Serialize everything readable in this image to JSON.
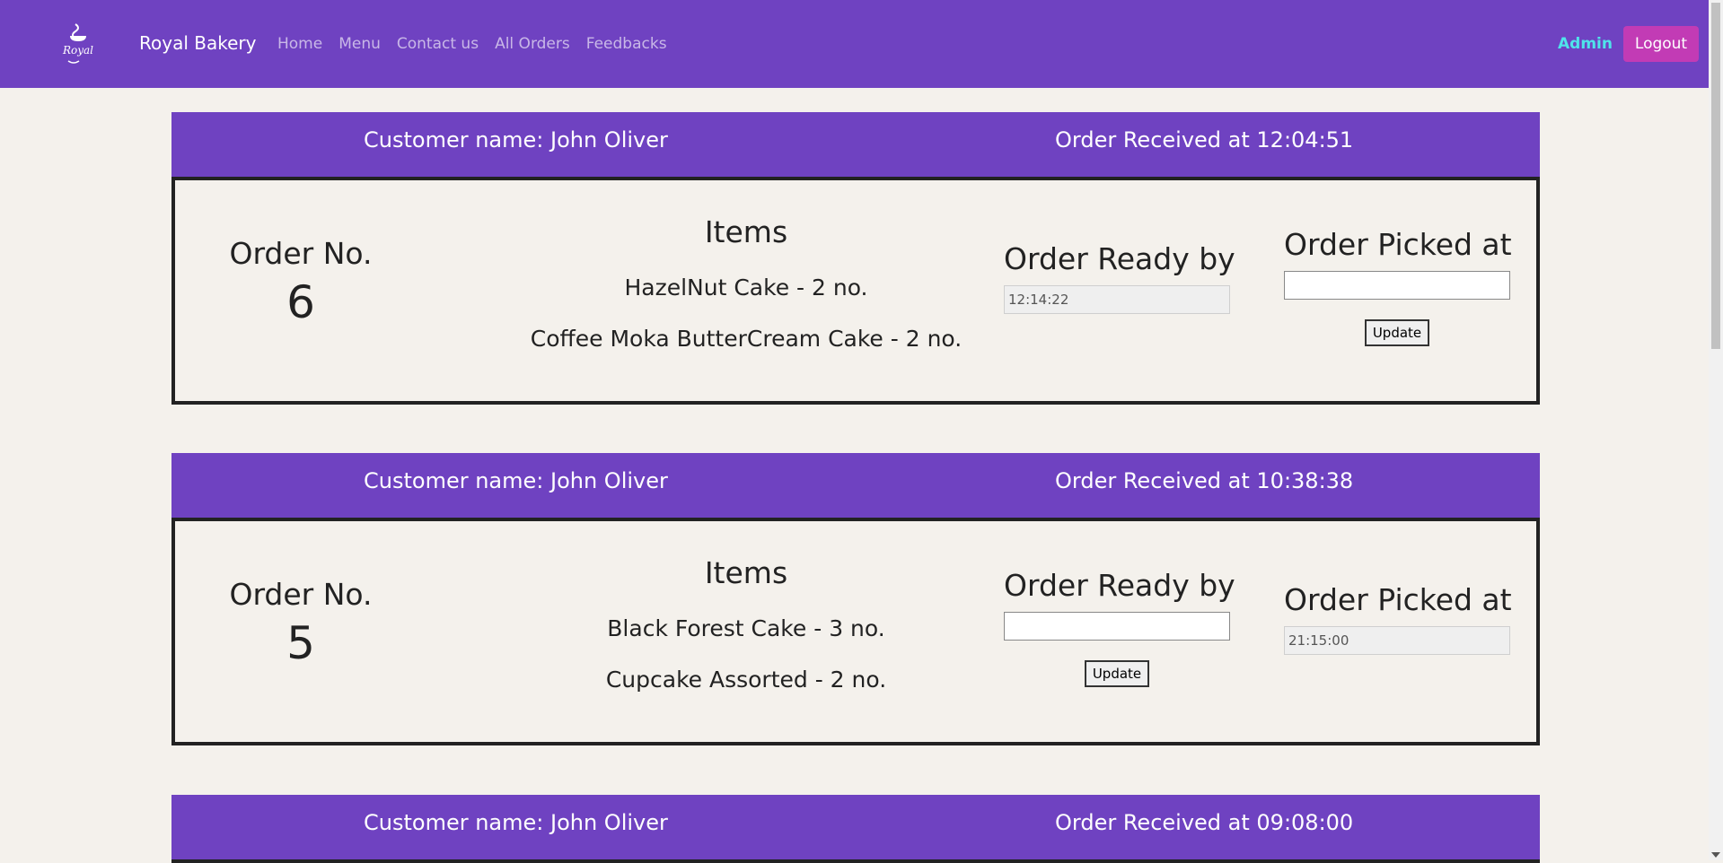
{
  "navbar": {
    "brand": "Royal Bakery",
    "logo_text": "Royal",
    "links": [
      "Home",
      "Menu",
      "Contact us",
      "All Orders",
      "Feedbacks"
    ],
    "admin_label": "Admin",
    "logout_label": "Logout"
  },
  "labels": {
    "order_no": "Order No.",
    "items": "Items",
    "ready_by": "Order Ready by",
    "picked_at": "Order Picked at",
    "update": "Update"
  },
  "orders": [
    {
      "customer": "Customer name: John Oliver",
      "received": "Order Received at 12:04:51",
      "number": "6",
      "items": [
        "HazelNut Cake - 2 no.",
        "Coffee Moka ButterCream Cake - 2 no."
      ],
      "ready_by": "12:14:22",
      "picked_at": ""
    },
    {
      "customer": "Customer name: John Oliver",
      "received": "Order Received at 10:38:38",
      "number": "5",
      "items": [
        "Black Forest Cake - 3 no.",
        "Cupcake Assorted - 2 no."
      ],
      "ready_by": "",
      "picked_at": "21:15:00"
    },
    {
      "customer": "Customer name: John Oliver",
      "received": "Order Received at 09:08:00"
    }
  ],
  "colors": {
    "primary": "#6f42c1",
    "logout": "#c23bb5",
    "admin": "#4fe4ea",
    "background": "#f4f1ec"
  }
}
